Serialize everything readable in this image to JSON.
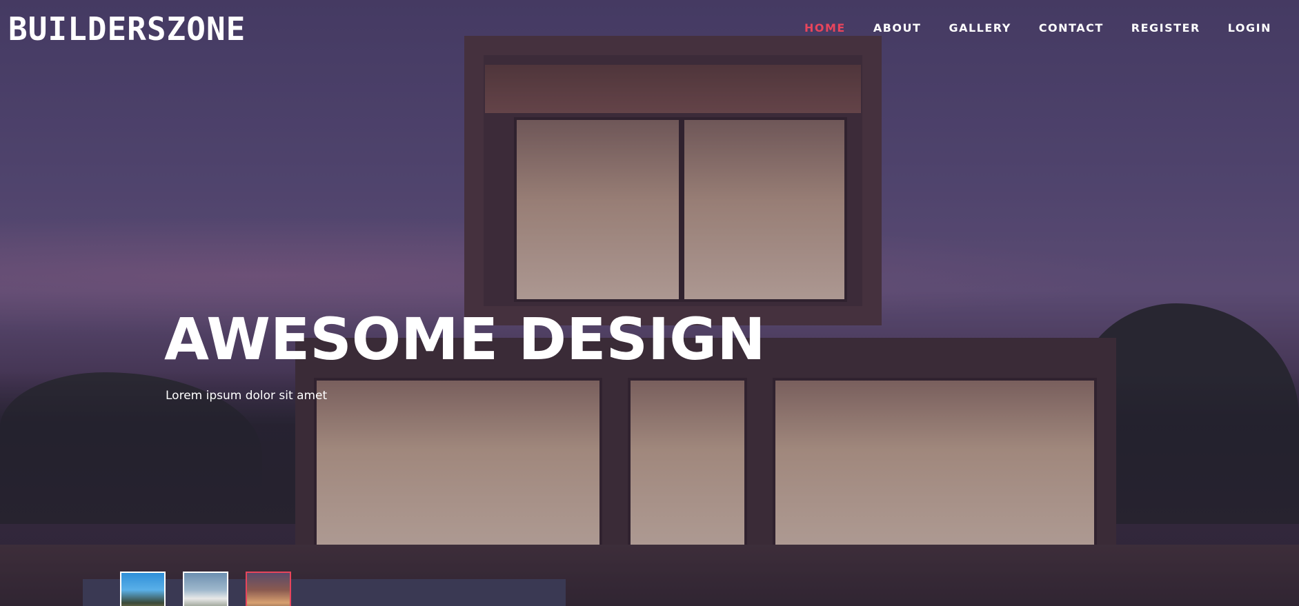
{
  "brand": {
    "logo_text": "BUILDERSZONE"
  },
  "nav": {
    "items": [
      {
        "label": "HOME",
        "active": true
      },
      {
        "label": "ABOUT",
        "active": false
      },
      {
        "label": "GALLERY",
        "active": false
      },
      {
        "label": "CONTACT",
        "active": false
      },
      {
        "label": "REGISTER",
        "active": false
      },
      {
        "label": "LOGIN",
        "active": false
      }
    ],
    "active_color": "#e8455c"
  },
  "hero": {
    "title": "AWESOME DESIGN",
    "subtitle": "Lorem ipsum dolor sit amet"
  },
  "slider": {
    "active_index": 2,
    "thumb_count": 3
  }
}
